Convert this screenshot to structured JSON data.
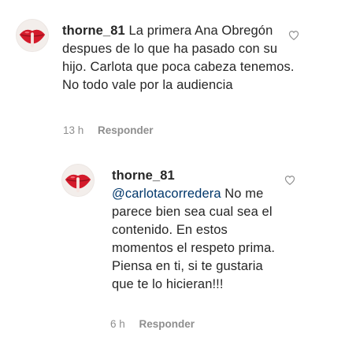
{
  "comments": [
    {
      "username": "thorne_81",
      "mention": "",
      "text": "La primera Ana Obregón despues de lo que ha pasado con su hijo. Carlota que poca cabeza tenemos. No todo vale por la audiencia",
      "time": "13 h",
      "reply_label": "Responder",
      "like_icon": "heart-outline-icon"
    },
    {
      "username": "thorne_81",
      "mention": "@carlotacorredera",
      "text": "No me parece bien sea cual sea el contenido. En estos momentos el respeto prima. Piensa en ti, si te gustaria que te lo hicieran!!!",
      "time": "6 h",
      "reply_label": "Responder",
      "like_icon": "heart-outline-icon"
    }
  ],
  "colors": {
    "text": "#262626",
    "muted": "#8e8e8e",
    "mention": "#00376b",
    "avatar_lips": "#d31b2b"
  }
}
